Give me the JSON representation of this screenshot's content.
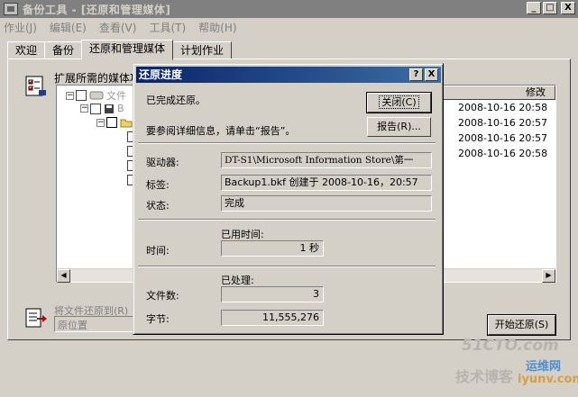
{
  "window": {
    "title": "备份工具 - [还原和管理媒体]",
    "min_glyph": "_",
    "max_glyph": "□",
    "close_glyph": "X"
  },
  "menu": [
    "作业(J)",
    "编辑(E)",
    "查看(V)",
    "工具(T)",
    "帮助(H)"
  ],
  "tabs": [
    {
      "label": "欢迎"
    },
    {
      "label": "备份"
    },
    {
      "label": "还原和管理媒体",
      "active": true
    },
    {
      "label": "计划作业"
    }
  ],
  "panel": {
    "expand_label": "扩展所需的媒体项",
    "tree": {
      "root_label": "文件",
      "child_label": "B"
    },
    "list": {
      "column_header": "修改",
      "dates": [
        "2008-10-16 20:58",
        "2008-10-16 20:57",
        "2008-10-16 20:57",
        "2008-10-16 20:58"
      ]
    },
    "restore_to_label": "将文件还原到(R)",
    "restore_to_value": "原位置",
    "start_restore_button": "开始还原(S)"
  },
  "dialog": {
    "title": "还原进度",
    "help_glyph": "?",
    "close_glyph": "X",
    "status_message": "已完成还原。",
    "details_hint": "要参阅详细信息，请单击“报告”。",
    "close_button": "关闭(C)",
    "report_button": "报告(R)...",
    "drive_label": "驱动器:",
    "drive_value": "DT-S1\\Microsoft Information Store\\第一",
    "label_label": "标签:",
    "label_value": "Backup1.bkf 创建于 2008-10-16，20:57",
    "state_label": "状态:",
    "state_value": "完成",
    "elapsed_header": "已用时间:",
    "time_label": "时间:",
    "time_value": "1 秒",
    "processed_header": "已处理:",
    "files_label": "文件数:",
    "files_value": "3",
    "bytes_label": "字节:",
    "bytes_value": "11,555,276"
  },
  "watermark": {
    "line1": "51CTO.com",
    "line2": "技术博客",
    "line3": "运维网",
    "line4": "iyunv.com"
  }
}
